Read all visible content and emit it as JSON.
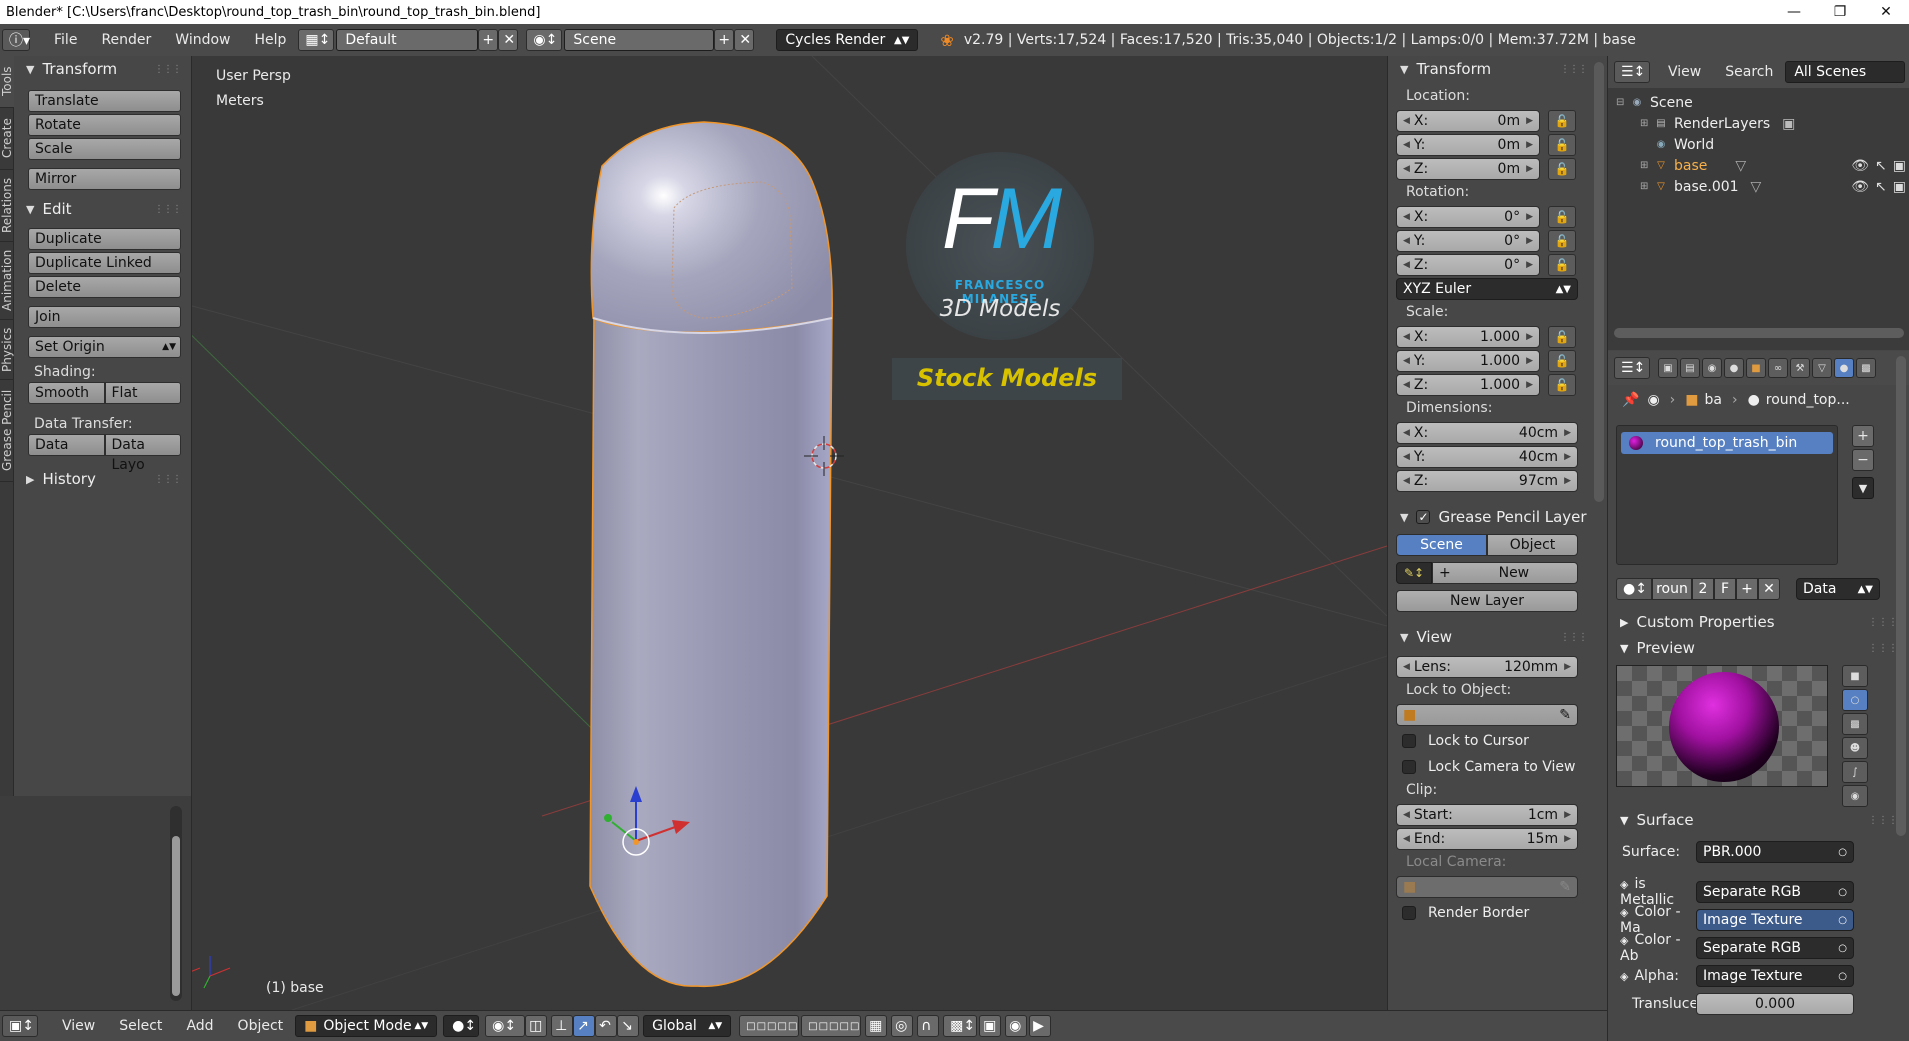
{
  "window": {
    "title": "Blender* [C:\\Users\\franc\\Desktop\\round_top_trash_bin\\round_top_trash_bin.blend]"
  },
  "info": {
    "menus": [
      "File",
      "Render",
      "Window",
      "Help"
    ],
    "layout": "Default",
    "scene": "Scene",
    "engine": "Cycles Render",
    "stats": "v2.79 | Verts:17,524 | Faces:17,520 | Tris:35,040 | Objects:1/2 | Lamps:0/0 | Mem:37.72M | base"
  },
  "tabs": [
    "Tools",
    "Create",
    "Relations",
    "Animation",
    "Physics",
    "Grease Pencil"
  ],
  "toolshelf": {
    "transform_title": "Transform",
    "translate": "Translate",
    "rotate": "Rotate",
    "scale": "Scale",
    "mirror": "Mirror",
    "edit_title": "Edit",
    "duplicate": "Duplicate",
    "duplicate_linked": "Duplicate Linked",
    "delete": "Delete",
    "join": "Join",
    "set_origin": "Set Origin",
    "shading_label": "Shading:",
    "smooth": "Smooth",
    "flat": "Flat",
    "data_transfer_label": "Data Transfer:",
    "data": "Data",
    "data_layout": "Data Layo",
    "history_title": "History"
  },
  "viewport": {
    "view_name": "User Persp",
    "units": "Meters",
    "object_label": "(1) base",
    "logo_initials": "FM",
    "logo_name": "FRANCESCO MILANESE",
    "logo_sub": "3D Models",
    "logo_banner": "Stock Models"
  },
  "footer": {
    "menus": [
      "View",
      "Select",
      "Add",
      "Object"
    ],
    "mode": "Object Mode",
    "orientation": "Global"
  },
  "npanel": {
    "transform_title": "Transform",
    "location_label": "Location:",
    "location": [
      {
        "axis": "X:",
        "value": "0m"
      },
      {
        "axis": "Y:",
        "value": "0m"
      },
      {
        "axis": "Z:",
        "value": "0m"
      }
    ],
    "rotation_label": "Rotation:",
    "rotation": [
      {
        "axis": "X:",
        "value": "0°"
      },
      {
        "axis": "Y:",
        "value": "0°"
      },
      {
        "axis": "Z:",
        "value": "0°"
      }
    ],
    "rotation_mode": "XYZ Euler",
    "scale_label": "Scale:",
    "scale": [
      {
        "axis": "X:",
        "value": "1.000"
      },
      {
        "axis": "Y:",
        "value": "1.000"
      },
      {
        "axis": "Z:",
        "value": "1.000"
      }
    ],
    "dimensions_label": "Dimensions:",
    "dimensions": [
      {
        "axis": "X:",
        "value": "40cm"
      },
      {
        "axis": "Y:",
        "value": "40cm"
      },
      {
        "axis": "Z:",
        "value": "97cm"
      }
    ],
    "gp_title": "Grease Pencil Layer",
    "gp_scene": "Scene",
    "gp_object": "Object",
    "gp_new": "New",
    "gp_new_layer": "New Layer",
    "view_title": "View",
    "lens_label": "Lens:",
    "lens_value": "120mm",
    "lock_to_object": "Lock to Object:",
    "lock_to_cursor": "Lock to Cursor",
    "lock_camera": "Lock Camera to View",
    "clip_label": "Clip:",
    "clip_start_label": "Start:",
    "clip_start": "1cm",
    "clip_end_label": "End:",
    "clip_end": "15m",
    "local_camera": "Local Camera:",
    "render_border": "Render Border"
  },
  "outliner": {
    "view": "View",
    "search": "Search",
    "filter": "All Scenes",
    "items": [
      {
        "label": "Scene",
        "indent": 0
      },
      {
        "label": "RenderLayers",
        "indent": 1
      },
      {
        "label": "World",
        "indent": 1
      },
      {
        "label": "base",
        "indent": 1
      },
      {
        "label": "base.001",
        "indent": 1
      }
    ]
  },
  "properties": {
    "breadcrumb_object": "ba",
    "breadcrumb_material": "round_top...",
    "material_slot": "round_top_trash_bin",
    "mat_name_short": "roun",
    "mat_users": "2",
    "mat_fake": "F",
    "link": "Data",
    "custom_props": "Custom Properties",
    "preview": "Preview",
    "surface_title": "Surface",
    "surface_label": "Surface:",
    "surface_value": "PBR.000",
    "inputs": [
      {
        "label": "is Metallic",
        "value": "Separate RGB"
      },
      {
        "label": "Color - Ma",
        "value": "Image Texture"
      },
      {
        "label": "Color - Ab",
        "value": "Separate RGB"
      },
      {
        "label": "Alpha:",
        "value": "Image Texture"
      }
    ],
    "translucent_label": "Transluce",
    "translucent_value": "0.000"
  },
  "colors": {
    "accent": "#5680c2",
    "selected_outline": "#f0962a",
    "logo_blue": "#29a9e0",
    "logo_yellow": "#d8c200"
  }
}
